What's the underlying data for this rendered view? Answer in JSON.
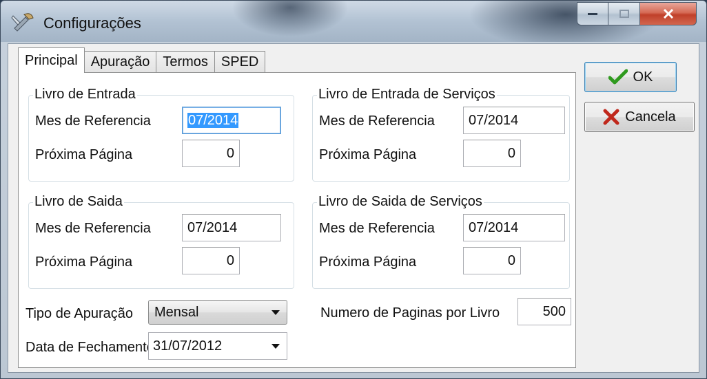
{
  "window": {
    "title": "Configurações"
  },
  "tabs": [
    {
      "label": "Principal",
      "active": true
    },
    {
      "label": "Apuração",
      "active": false
    },
    {
      "label": "Termos",
      "active": false
    },
    {
      "label": "SPED",
      "active": false
    }
  ],
  "groups": {
    "livro_entrada": {
      "title": "Livro de Entrada",
      "mes_label": "Mes de Referencia",
      "mes_value": "07/2014",
      "pagina_label": "Próxima Página",
      "pagina_value": "0"
    },
    "livro_entrada_servicos": {
      "title": "Livro de Entrada de Serviços",
      "mes_label": "Mes de Referencia",
      "mes_value": "07/2014",
      "pagina_label": "Próxima Página",
      "pagina_value": "0"
    },
    "livro_saida": {
      "title": "Livro de Saida",
      "mes_label": "Mes de Referencia",
      "mes_value": "07/2014",
      "pagina_label": "Próxima Página",
      "pagina_value": "0"
    },
    "livro_saida_servicos": {
      "title": "Livro de Saida de Serviços",
      "mes_label": "Mes de Referencia",
      "mes_value": "07/2014",
      "pagina_label": "Próxima Página",
      "pagina_value": "0"
    }
  },
  "tipo_apuracao": {
    "label": "Tipo de Apuração",
    "value": "Mensal"
  },
  "paginas_por_livro": {
    "label": "Numero de Paginas por Livro",
    "value": "500"
  },
  "data_fechamento": {
    "label": "Data de Fechamento",
    "value": "31/07/2012"
  },
  "buttons": {
    "ok": "OK",
    "cancela": "Cancela"
  },
  "colors": {
    "ok_icon": "#2f9a1e",
    "cancel_icon": "#c0281c",
    "selection": "#3399ff"
  }
}
